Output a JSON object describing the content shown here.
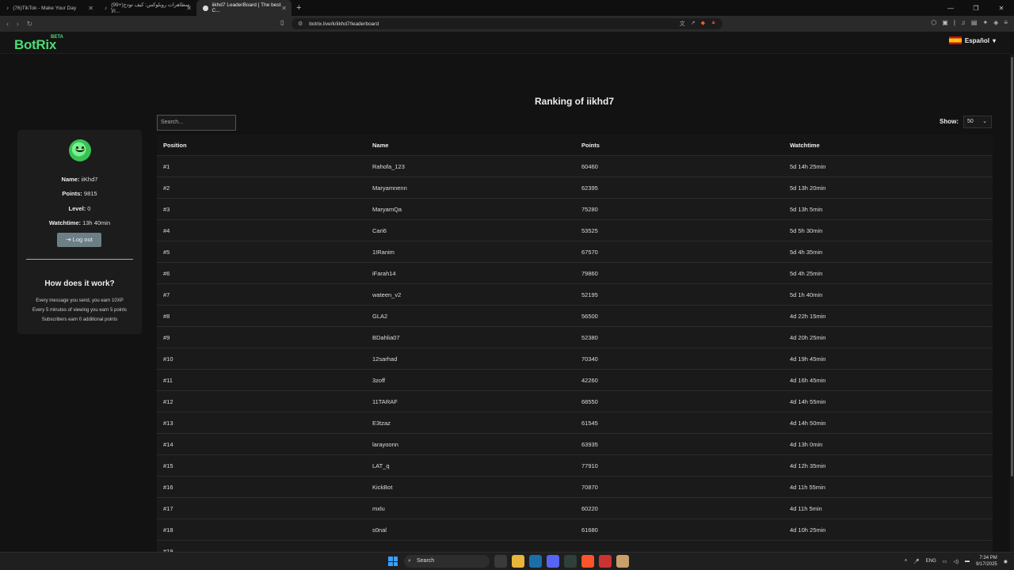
{
  "browser": {
    "tabs": [
      {
        "title": "(76)TikTok - Make Your Day",
        "active": false
      },
      {
        "title": "(99+)سطاهرات روبلوكس: كيف تودج الأ...",
        "active": false
      },
      {
        "title": "iikhd7 LeaderBoard | The best C...",
        "active": true
      }
    ],
    "url": "botrix.live/k/iikhd7/leaderboard"
  },
  "site": {
    "logo": "BotRix",
    "beta": "BETA",
    "language": "Español"
  },
  "page": {
    "title": "Ranking of iikhd7",
    "search_placeholder": "Search...",
    "show_label": "Show:",
    "show_value": "50"
  },
  "profile": {
    "name_label": "Name:",
    "name": "iiKhd7",
    "points_label": "Points:",
    "points": "9815",
    "level_label": "Level:",
    "level": "0",
    "watchtime_label": "Watchtime:",
    "watchtime": "13h 40min",
    "logout": "Log out"
  },
  "how": {
    "title": "How does it work?",
    "lines": [
      "Every message you send, you earn 10XP",
      "Every 5 minutes of viewing you earn 5 points",
      "Subscribers earn 0 additional points"
    ]
  },
  "table": {
    "headers": [
      "Position",
      "Name",
      "Points",
      "Watchtime"
    ],
    "rows": [
      [
        "#1",
        "Rahofa_123",
        "60460",
        "5d 14h 25min"
      ],
      [
        "#2",
        "Maryamnenn",
        "62395",
        "5d 13h 20min"
      ],
      [
        "#3",
        "MaryamQa",
        "75280",
        "5d 13h 5min"
      ],
      [
        "#4",
        "Cari6",
        "53525",
        "5d 5h 30min"
      ],
      [
        "#5",
        "1IRanim",
        "67570",
        "5d 4h 35min"
      ],
      [
        "#6",
        "iFarah14",
        "79860",
        "5d 4h 25min"
      ],
      [
        "#7",
        "wateen_v2",
        "52195",
        "5d 1h 40min"
      ],
      [
        "#8",
        "GLA2",
        "56500",
        "4d 22h 15min"
      ],
      [
        "#9",
        "BDahlia07",
        "52380",
        "4d 20h 25min"
      ],
      [
        "#10",
        "12sarhad",
        "70340",
        "4d 19h 45min"
      ],
      [
        "#11",
        "3zoff",
        "42260",
        "4d 16h 45min"
      ],
      [
        "#12",
        "11TARAF",
        "68550",
        "4d 14h 55min"
      ],
      [
        "#13",
        "E3tzaz",
        "61545",
        "4d 14h 50min"
      ],
      [
        "#14",
        "larayoonn",
        "63935",
        "4d 13h 0min"
      ],
      [
        "#15",
        "LAT_q",
        "77910",
        "4d 12h 35min"
      ],
      [
        "#16",
        "KickBot",
        "70870",
        "4d 11h 55min"
      ],
      [
        "#17",
        "mxlu",
        "60220",
        "4d 11h 5min"
      ],
      [
        "#18",
        "s0nal",
        "61680",
        "4d 10h 25min"
      ],
      [
        "#19",
        "",
        "",
        ""
      ]
    ]
  },
  "taskbar": {
    "search": "Search",
    "lang": "ENG",
    "time": "7:34 PM",
    "date": "9/17/2025"
  }
}
